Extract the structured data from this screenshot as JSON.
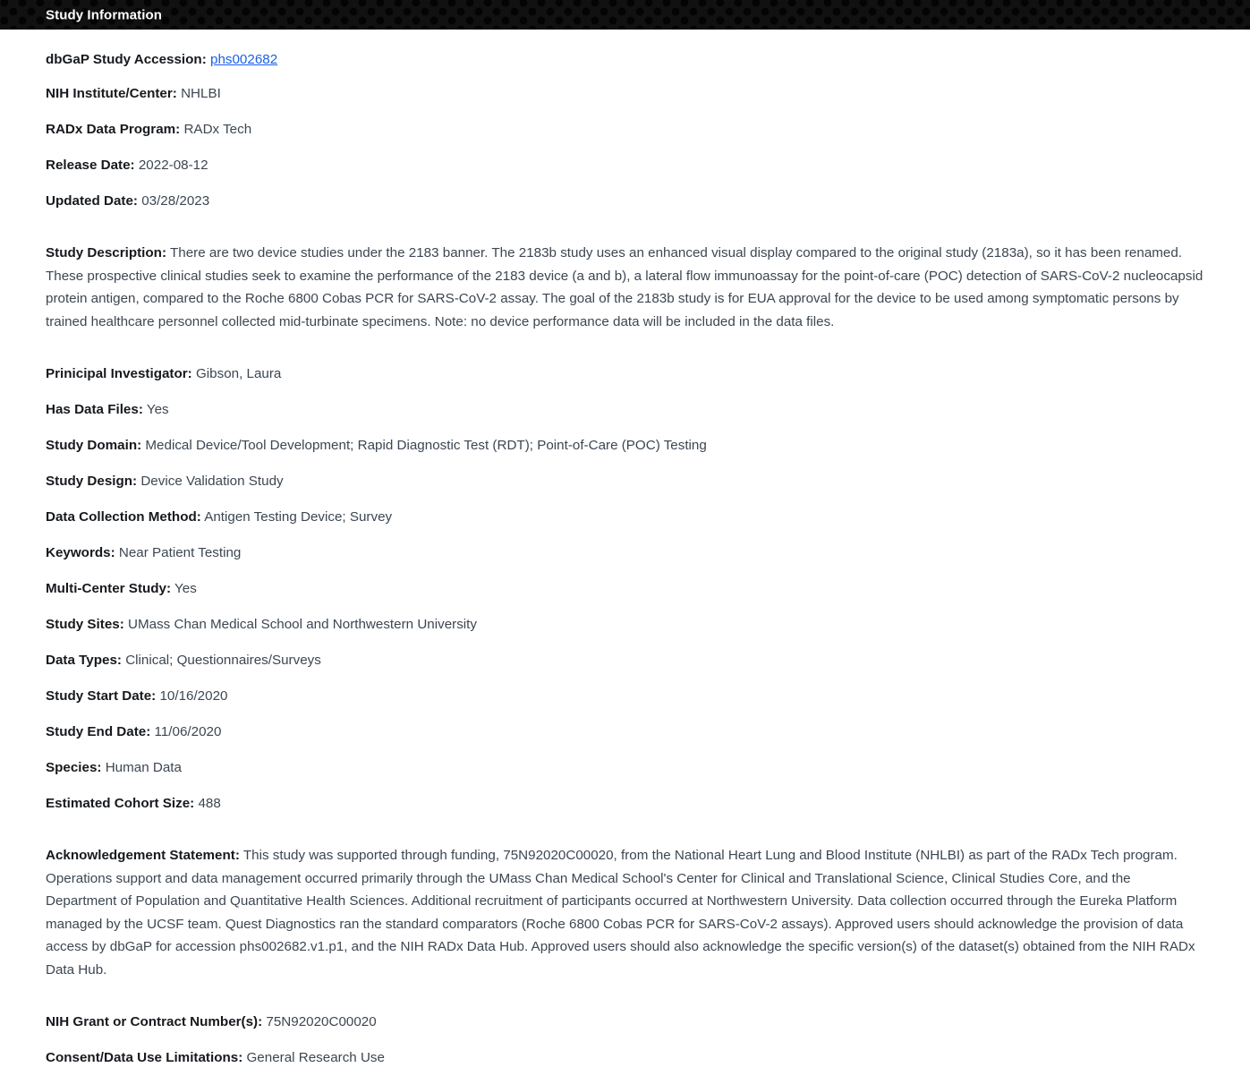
{
  "banner": {
    "title": "Study Information"
  },
  "fields": {
    "accession": {
      "label": "dbGaP Study Accession:",
      "link_text": "phs002682"
    },
    "institute": {
      "label": "NIH Institute/Center:",
      "value": "NHLBI"
    },
    "program": {
      "label": "RADx Data Program:",
      "value": "RADx Tech"
    },
    "release_date": {
      "label": "Release Date:",
      "value": "2022-08-12"
    },
    "updated_date": {
      "label": "Updated Date:",
      "value": "03/28/2023"
    },
    "description": {
      "label": "Study Description:",
      "value": "There are two device studies under the 2183 banner. The 2183b study uses an enhanced visual display compared to the original study (2183a), so it has been renamed. These prospective clinical studies seek to examine the performance of the 2183 device (a and b), a lateral flow immunoassay for the point-of-care (POC) detection of SARS-CoV-2 nucleocapsid protein antigen, compared to the Roche 6800 Cobas PCR for SARS-CoV-2 assay. The goal of the 2183b study is for EUA approval for the device to be used among symptomatic persons by trained healthcare personnel collected mid-turbinate specimens. Note: no device performance data will be included in the data files."
    },
    "principal_investigator": {
      "label": "Prinicipal Investigator:",
      "value": "Gibson, Laura"
    },
    "has_data_files": {
      "label": "Has Data Files:",
      "value": "Yes"
    },
    "study_domain": {
      "label": "Study Domain:",
      "value": "Medical Device/Tool Development; Rapid Diagnostic Test (RDT); Point-of-Care (POC) Testing"
    },
    "study_design": {
      "label": "Study Design:",
      "value": "Device Validation Study"
    },
    "data_collection_method": {
      "label": "Data Collection Method:",
      "value": "Antigen Testing Device; Survey"
    },
    "keywords": {
      "label": "Keywords:",
      "value": "Near Patient Testing"
    },
    "multi_center": {
      "label": "Multi-Center Study:",
      "value": "Yes"
    },
    "study_sites": {
      "label": "Study Sites:",
      "value": "UMass Chan Medical School and Northwestern University"
    },
    "data_types": {
      "label": "Data Types:",
      "value": "Clinical; Questionnaires/Surveys"
    },
    "study_start_date": {
      "label": "Study Start Date:",
      "value": "10/16/2020"
    },
    "study_end_date": {
      "label": "Study End Date:",
      "value": "11/06/2020"
    },
    "species": {
      "label": "Species:",
      "value": "Human Data"
    },
    "cohort_size": {
      "label": "Estimated Cohort Size:",
      "value": "488"
    },
    "acknowledgement": {
      "label": "Acknowledgement Statement:",
      "value": "This study was supported through funding, 75N92020C00020, from the National Heart Lung and Blood Institute (NHLBI) as part of the RADx Tech program. Operations support and data management occurred primarily through the UMass Chan Medical School's Center for Clinical and Translational Science, Clinical Studies Core, and the Department of Population and Quantitative Health Sciences. Additional recruitment of participants occurred at Northwestern University. Data collection occurred through the Eureka Platform managed by the UCSF team. Quest Diagnostics ran the standard comparators (Roche 6800 Cobas PCR for SARS-CoV-2 assays). Approved users should acknowledge the provision of data access by dbGaP for accession phs002682.v1.p1, and the NIH RADx Data Hub. Approved users should also acknowledge the specific version(s) of the dataset(s) obtained from the NIH RADx Data Hub."
    },
    "grant_number": {
      "label": "NIH Grant or Contract Number(s):",
      "value": "75N92020C00020"
    },
    "consent": {
      "label": "Consent/Data Use Limitations:",
      "value": "General Research Use"
    }
  },
  "colors": {
    "banner_background": "#111111",
    "banner_dots": "#040404",
    "label_text": "#16191d",
    "value_text": "#3c4652",
    "link": "#1a5fe6",
    "page_background": "#ffffff"
  }
}
